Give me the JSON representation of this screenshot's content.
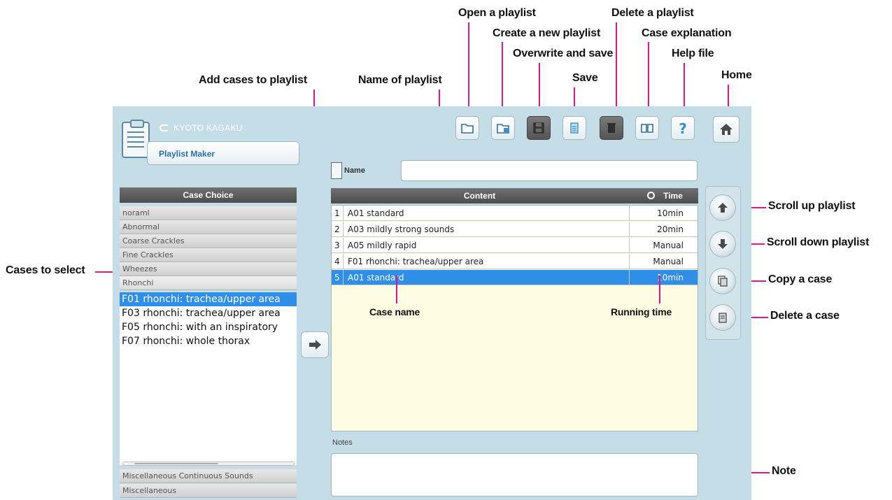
{
  "annotations": {
    "open_playlist": "Open a playlist",
    "create_playlist": "Create a new playlist",
    "overwrite_save": "Overwrite and save",
    "save": "Save",
    "delete_playlist": "Delete a playlist",
    "case_explanation": "Case explanation",
    "help_file": "Help file",
    "home": "Home",
    "add_cases": "Add cases to playlist",
    "name_of_playlist": "Name of playlist",
    "cases_to_select": "Cases to select",
    "scroll_up": "Scroll up playlist",
    "scroll_down": "Scroll down playlist",
    "copy_case": "Copy a case",
    "delete_case": "Delete a case",
    "note": "Note",
    "case_name": "Case name",
    "running_time": "Running time"
  },
  "app": {
    "brand": "KYOTO KAGAKU",
    "title": "Playlist Maker"
  },
  "toolbar": {
    "icons": [
      "folder-open-icon",
      "folder-new-icon",
      "floppy-disk-icon",
      "save-icon",
      "trash-icon",
      "book-icon",
      "question-icon",
      "home-icon"
    ]
  },
  "name_row": {
    "label": "Name",
    "value": ""
  },
  "case_choice": {
    "header": "Case Choice",
    "categories_top": [
      "noraml",
      "Abnormal",
      "Coarse Crackles",
      "Fine Crackles",
      "Wheezes",
      "Rhonchi"
    ],
    "cases": [
      "F01 rhonchi: trachea/upper area",
      "F03 rhonchi: trachea/upper area",
      "F05 rhonchi: with an inspiratory",
      "F07 rhonchi: whole thorax"
    ],
    "selected_case_index": 0,
    "categories_bottom": [
      "Miscellaneous Continuous Sounds",
      "Miscellaneous"
    ]
  },
  "content_table": {
    "header_content": "Content",
    "header_time": "Time",
    "rows": [
      {
        "n": "1",
        "content": "A01 standard",
        "time": "10min"
      },
      {
        "n": "2",
        "content": "A03 mildly strong sounds",
        "time": "20min"
      },
      {
        "n": "3",
        "content": "A05 mildly rapid",
        "time": "Manual"
      },
      {
        "n": "4",
        "content": "F01 rhonchi: trachea/upper area",
        "time": "Manual"
      },
      {
        "n": "5",
        "content": "A01 standard",
        "time": "10min"
      }
    ],
    "selected_row_index": 4
  },
  "notes": {
    "label": "Notes",
    "value": ""
  },
  "colors": {
    "annotation_line": "#e0168a",
    "selection": "#2f8fe8",
    "panel_bg": "#c4dde6"
  }
}
